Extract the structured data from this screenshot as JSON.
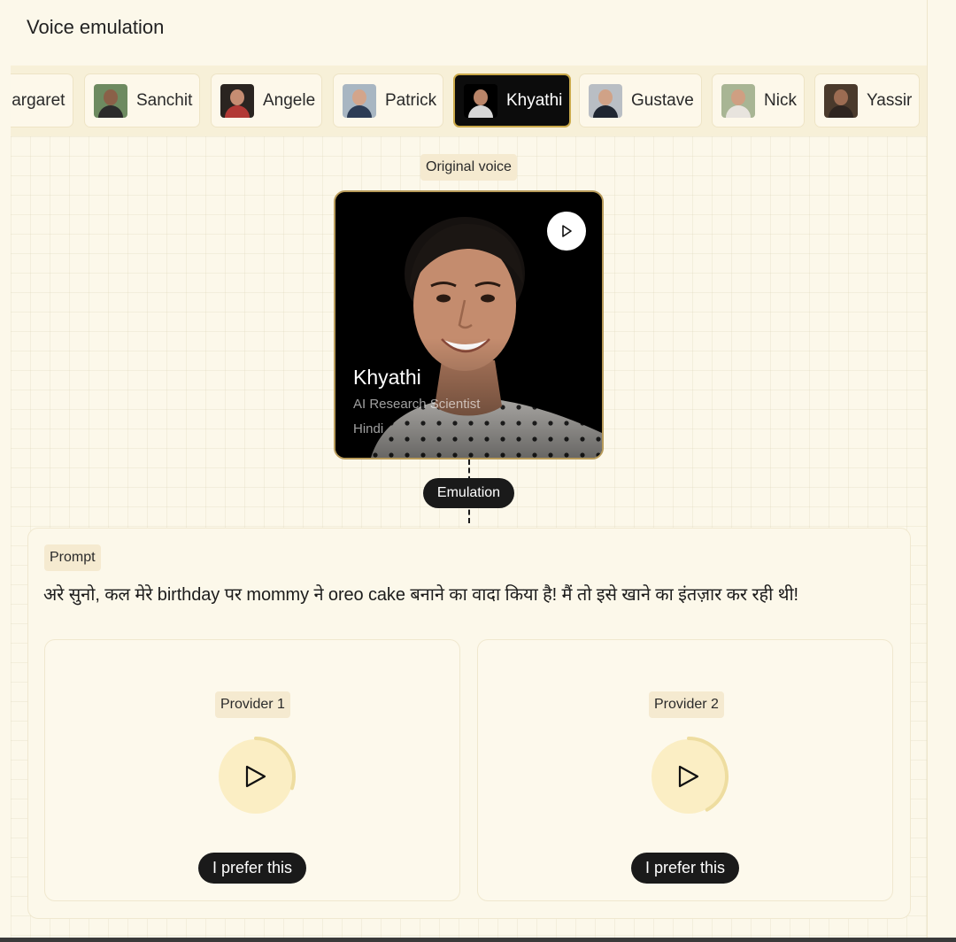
{
  "title": "Voice emulation",
  "voices": [
    {
      "name": "largaret",
      "active": false
    },
    {
      "name": "Sanchit",
      "active": false
    },
    {
      "name": "Angele",
      "active": false
    },
    {
      "name": "Patrick",
      "active": false
    },
    {
      "name": "Khyathi",
      "active": true
    },
    {
      "name": "Gustave",
      "active": false
    },
    {
      "name": "Nick",
      "active": false
    },
    {
      "name": "Yassir",
      "active": false
    }
  ],
  "original_voice_label": "Original voice",
  "speaker": {
    "name": "Khyathi",
    "role": "AI Research Scientist",
    "language": "Hindi"
  },
  "emulation_label": "Emulation",
  "prompt": {
    "label": "Prompt",
    "text": "अरे सुनो, कल मेरे birthday पर mommy ने oreo cake बनाने का वादा किया है! मैं तो इसे खाने का इंतज़ार कर रही थी!"
  },
  "providers": [
    {
      "label": "Provider 1",
      "prefer_label": "I prefer this",
      "progress": 0.3
    },
    {
      "label": "Provider 2",
      "prefer_label": "I prefer this",
      "progress": 0.42
    }
  ],
  "colors": {
    "background": "#fcf8ea",
    "tag": "#f5ead0",
    "play_fill": "#fbeec4",
    "progress_ring": "#eedda0",
    "dark": "#1a1a1a",
    "active_border": "#caa94a"
  },
  "icons": {
    "play": "play-icon"
  }
}
